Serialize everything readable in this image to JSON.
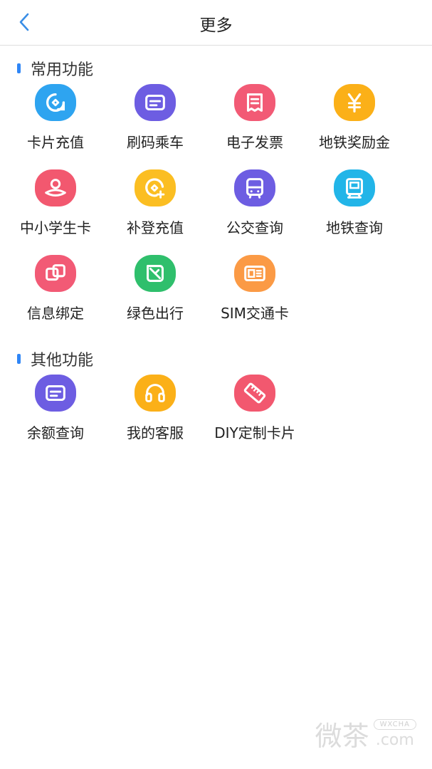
{
  "header": {
    "title": "更多"
  },
  "sections": [
    {
      "title": "常用功能",
      "items": [
        {
          "label": "卡片充值",
          "icon": "card-recharge-icon",
          "color": "#2ea4f0"
        },
        {
          "label": "刷码乘车",
          "icon": "qr-ride-icon",
          "color": "#6d5de2"
        },
        {
          "label": "电子发票",
          "icon": "e-invoice-icon",
          "color": "#f25a75"
        },
        {
          "label": "地铁奖励金",
          "icon": "yen-reward-icon",
          "color": "#fbb018"
        },
        {
          "label": "中小学生卡",
          "icon": "student-card-icon",
          "color": "#f2586f"
        },
        {
          "label": "补登充值",
          "icon": "top-up-icon",
          "color": "#fbbe22"
        },
        {
          "label": "公交查询",
          "icon": "bus-icon",
          "color": "#6d5de2"
        },
        {
          "label": "地铁查询",
          "icon": "metro-icon",
          "color": "#22b5e8"
        },
        {
          "label": "信息绑定",
          "icon": "bind-info-icon",
          "color": "#f25a75"
        },
        {
          "label": "绿色出行",
          "icon": "green-leaf-icon",
          "color": "#2fbf6c"
        },
        {
          "label": "SIM交通卡",
          "icon": "sim-card-icon",
          "color": "#fb9a45"
        }
      ]
    },
    {
      "title": "其他功能",
      "items": [
        {
          "label": "余额查询",
          "icon": "balance-query-icon",
          "color": "#6d5de2"
        },
        {
          "label": "我的客服",
          "icon": "headset-icon",
          "color": "#fbb018"
        },
        {
          "label": "DIY定制卡片",
          "icon": "diy-card-icon",
          "color": "#f2586f"
        }
      ]
    }
  ],
  "watermark": {
    "main": "微茶",
    "pill": "WXCHA",
    "suffix": ".com"
  }
}
